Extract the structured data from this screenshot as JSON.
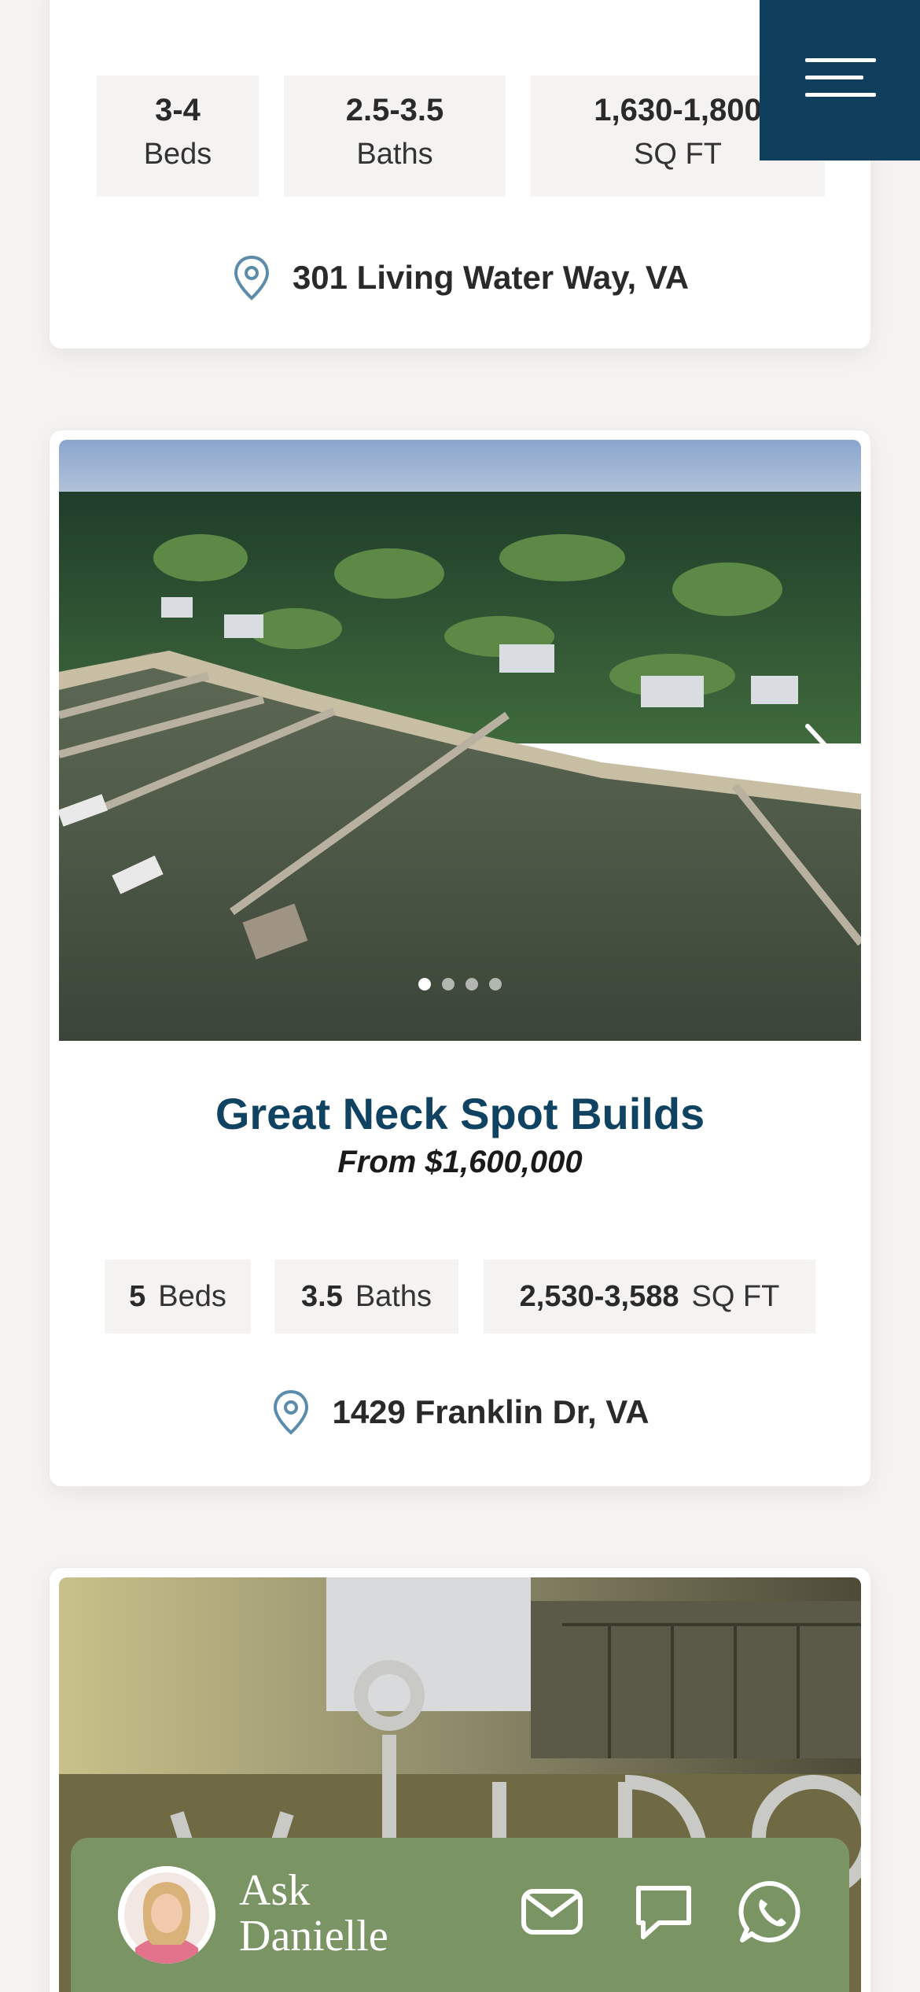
{
  "cards": [
    {
      "stats": [
        {
          "value": "3-4",
          "label": "Beds"
        },
        {
          "value": "2.5-3.5",
          "label": "Baths"
        },
        {
          "value": "1,630-1,800",
          "label": "SQ FT"
        }
      ],
      "address": "301 Living Water Way, VA"
    },
    {
      "title": "Great Neck Spot Builds",
      "price": "From $1,600,000",
      "carousel": {
        "slide_count": 4,
        "active_index": 0
      },
      "stats": [
        {
          "value": "5",
          "label": "Beds"
        },
        {
          "value": "3.5",
          "label": "Baths"
        },
        {
          "value": "2,530-3,588",
          "label": "SQ FT"
        }
      ],
      "address": "1429 Franklin Dr, VA"
    }
  ],
  "ask_bar": {
    "line1": "Ask",
    "line2": "Danielle",
    "icons": [
      "email-icon",
      "chat-icon",
      "whatsapp-icon"
    ]
  },
  "colors": {
    "brand_navy": "#0f3f5c",
    "title_blue": "#0f4361",
    "ask_green": "#7a9464",
    "pin_blue": "#5b8cab",
    "stat_bg": "#f4f3f1"
  }
}
